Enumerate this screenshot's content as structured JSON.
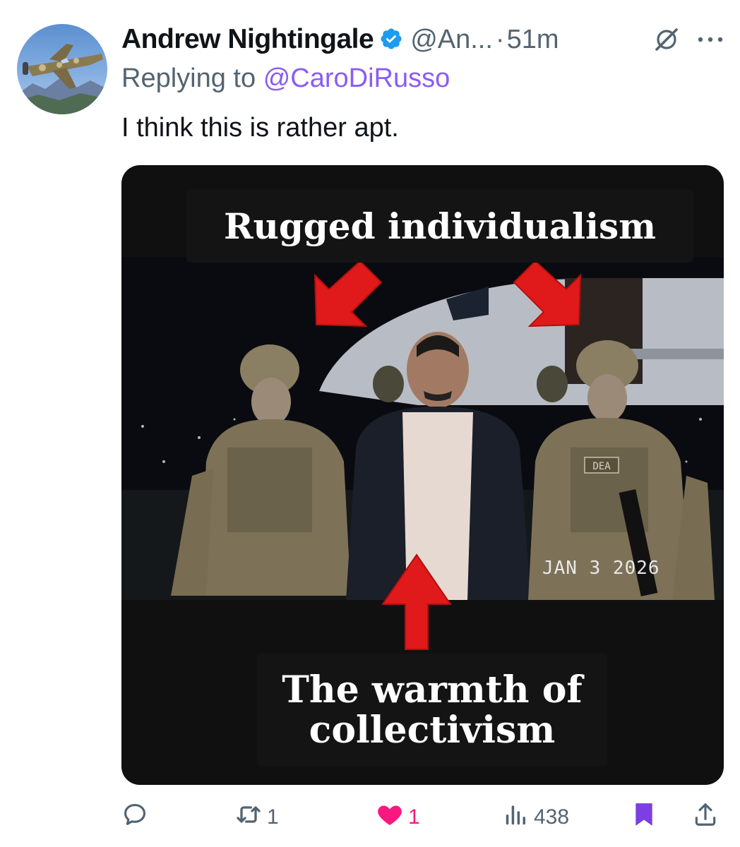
{
  "author": {
    "name": "Andrew Nightingale",
    "handle": "@An...",
    "separator": "·",
    "time": "51m"
  },
  "reply": {
    "prefix": "Replying to",
    "mention": "@CaroDiRusso"
  },
  "tweet_text": "I think this is rather apt.",
  "media": {
    "caption_top": "Rugged individualism",
    "caption_bottom_line1": "The warmth of",
    "caption_bottom_line2": "collectivism",
    "date_stamp": "JAN  3 2026",
    "vest_patch": "DEA"
  },
  "actions": {
    "reply_icon": "comment-bubble-icon",
    "retweet_icon": "retweet-icon",
    "retweet_count": "1",
    "like_icon": "heart-filled-icon",
    "like_count": "1",
    "views_icon": "bar-chart-icon",
    "views_count": "438",
    "bookmark_icon": "bookmark-filled-icon",
    "share_icon": "share-upload-icon"
  },
  "colors": {
    "accent_purple": "#8b5cf6",
    "verified_blue": "#1d9bf0",
    "like_pink": "#f91880",
    "secondary_text": "#536471",
    "arrow_red": "#e01a1a"
  }
}
